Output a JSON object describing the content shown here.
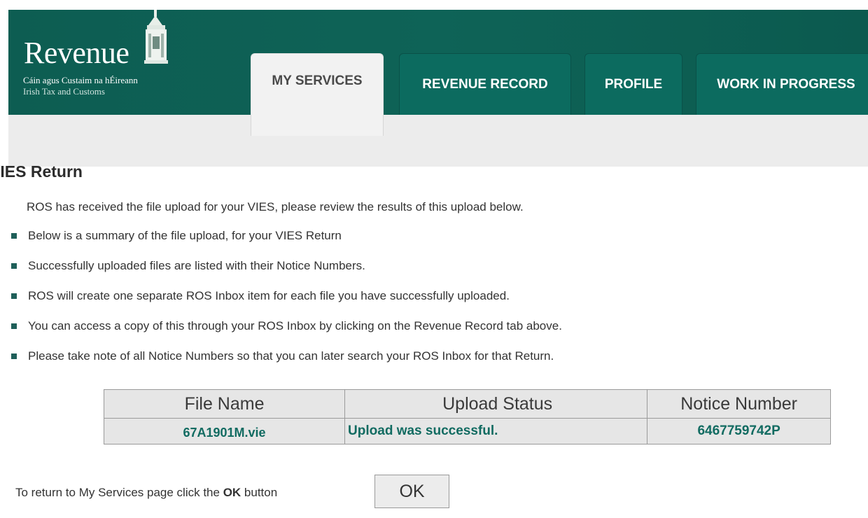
{
  "brand": {
    "name": "Revenue",
    "irish_line": "Cáin agus Custaim na hÉireann",
    "english_line": "Irish Tax and Customs",
    "crest_icon": "revenue-custom-house-crest-icon"
  },
  "tabs": [
    {
      "label": "MY SERVICES",
      "active": true
    },
    {
      "label": "REVENUE RECORD",
      "active": false
    },
    {
      "label": "PROFILE",
      "active": false
    },
    {
      "label": "WORK IN PROGRESS",
      "active": false
    }
  ],
  "page": {
    "title": "VIES Return",
    "title_visible": "/IES Return",
    "intro": "ROS has received the file upload for your VIES, please review the results of this upload below.",
    "bullets": [
      "Below is a summary of the file upload, for your VIES Return",
      "Successfully uploaded files are listed with their Notice Numbers.",
      "ROS will create one separate ROS Inbox item for each file you have successfully uploaded.",
      "You can access a copy of this through your ROS Inbox by clicking on the Revenue Record tab above.",
      "Please take note of all Notice Numbers so that you can later search your ROS Inbox for that Return."
    ]
  },
  "results_table": {
    "headers": [
      "File Name",
      "Upload Status",
      "Notice Number"
    ],
    "rows": [
      [
        "67A1901M.vie",
        "Upload was successful.",
        "6467759742P"
      ]
    ]
  },
  "footer": {
    "return_text_prefix": "To return to My Services page click the ",
    "return_text_bold": "OK",
    "return_text_suffix": " button",
    "ok_label": "OK"
  },
  "colors": {
    "header_green": "#0e6357",
    "tab_green": "#0c6b5f",
    "link_green": "#116b61",
    "bullet": "#1f5f59"
  }
}
